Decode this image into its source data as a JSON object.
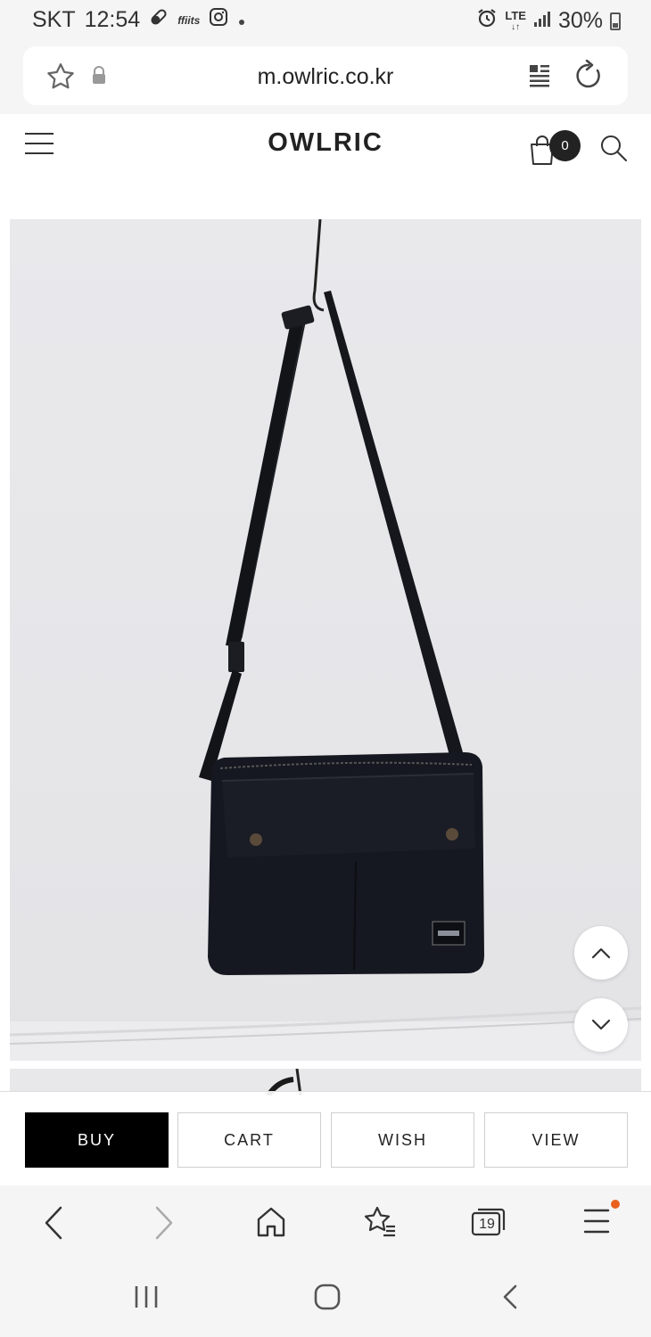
{
  "status_bar": {
    "carrier": "SKT",
    "time": "12:54",
    "app_tag": "ffiits",
    "network_top": "LTE",
    "network_bottom": "↓↑",
    "battery": "30%"
  },
  "url_bar": {
    "url": "m.owlric.co.kr"
  },
  "site": {
    "logo": "OWLRIC",
    "cart_count": "0"
  },
  "product": {
    "image_icon": "crossbody-bag-photo"
  },
  "actions": {
    "buy": "BUY",
    "cart": "CART",
    "wish": "WISH",
    "view": "VIEW"
  },
  "browser_toolbar": {
    "tabs_count": "19"
  },
  "colors": {
    "accent_dot": "#e8601c",
    "buy_bg": "#000000"
  }
}
